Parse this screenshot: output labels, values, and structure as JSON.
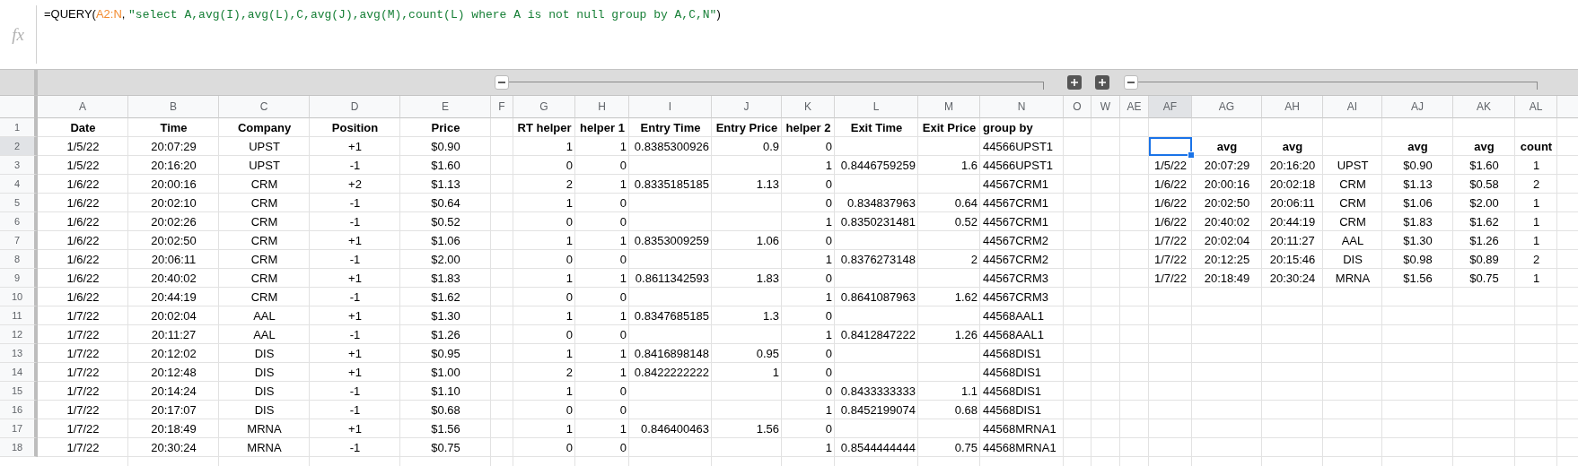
{
  "formula_bar": {
    "fx_label": "fx",
    "formula_parts": [
      {
        "kind": "plain",
        "text": "=QUERY("
      },
      {
        "kind": "range",
        "text": "A2:N"
      },
      {
        "kind": "plain",
        "text": ", "
      },
      {
        "kind": "string",
        "text": "\"select A,avg(I),avg(L),C,avg(J),avg(M),count(L) where A is not null group by A,C,N\""
      },
      {
        "kind": "plain",
        "text": ")"
      }
    ]
  },
  "column_groups": [
    {
      "expanded": true
    },
    {
      "expanded": false
    },
    {
      "expanded": false
    },
    {
      "expanded": true
    }
  ],
  "columns": [
    {
      "label": "A",
      "selected": false
    },
    {
      "label": "B",
      "selected": false
    },
    {
      "label": "C",
      "selected": false
    },
    {
      "label": "D",
      "selected": false
    },
    {
      "label": "E",
      "selected": false
    },
    {
      "label": "F",
      "selected": false
    },
    {
      "label": "G",
      "selected": false
    },
    {
      "label": "H",
      "selected": false
    },
    {
      "label": "I",
      "selected": false
    },
    {
      "label": "J",
      "selected": false
    },
    {
      "label": "K",
      "selected": false
    },
    {
      "label": "L",
      "selected": false
    },
    {
      "label": "M",
      "selected": false
    },
    {
      "label": "N",
      "selected": false
    },
    {
      "label": "O",
      "selected": false
    },
    {
      "label": "W",
      "selected": false
    },
    {
      "label": "AE",
      "selected": false
    },
    {
      "label": "AF",
      "selected": true
    },
    {
      "label": "AG",
      "selected": false
    },
    {
      "label": "AH",
      "selected": false
    },
    {
      "label": "AI",
      "selected": false
    },
    {
      "label": "AJ",
      "selected": false
    },
    {
      "label": "AK",
      "selected": false
    },
    {
      "label": "AL",
      "selected": false
    }
  ],
  "rows": [
    {
      "number": "1",
      "selected": false,
      "cells": [
        {
          "kind": "header",
          "text": "Date"
        },
        {
          "kind": "header",
          "text": "Time"
        },
        {
          "kind": "header",
          "text": "Company"
        },
        {
          "kind": "header",
          "text": "Position"
        },
        {
          "kind": "header",
          "text": "Price"
        },
        null,
        {
          "kind": "header",
          "text": "RT helper"
        },
        {
          "kind": "header",
          "text": "helper 1"
        },
        {
          "kind": "header",
          "text": "Entry Time"
        },
        {
          "kind": "header",
          "text": "Entry Price"
        },
        {
          "kind": "header",
          "text": "helper 2"
        },
        {
          "kind": "header",
          "text": "Exit Time"
        },
        {
          "kind": "header",
          "text": "Exit Price"
        },
        {
          "kind": "header",
          "text": "group by"
        }
      ]
    },
    {
      "number": "2",
      "selected": true,
      "cells": [
        "1/5/22",
        "20:07:29",
        "UPST",
        "+1",
        "$0.90",
        null,
        "1",
        "1",
        "0.8385300926",
        "0.9",
        "0",
        null,
        null,
        "44566UPST1",
        null,
        null,
        null,
        null,
        {
          "kind": "header",
          "text": "avg"
        },
        {
          "kind": "header",
          "text": "avg"
        },
        null,
        {
          "kind": "header",
          "text": "avg"
        },
        {
          "kind": "header",
          "text": "avg"
        },
        {
          "kind": "header",
          "text": "count"
        }
      ]
    },
    {
      "number": "3",
      "selected": false,
      "cells": [
        "1/5/22",
        "20:16:20",
        "UPST",
        "-1",
        "$1.60",
        null,
        "0",
        "0",
        null,
        null,
        "1",
        "0.8446759259",
        "1.6",
        "44566UPST1",
        null,
        null,
        null,
        "1/5/22",
        "20:07:29",
        "20:16:20",
        "UPST",
        "$0.90",
        "$1.60",
        "1"
      ]
    },
    {
      "number": "4",
      "selected": false,
      "cells": [
        "1/6/22",
        "20:00:16",
        "CRM",
        "+2",
        "$1.13",
        null,
        "2",
        "1",
        "0.8335185185",
        "1.13",
        "0",
        null,
        null,
        "44567CRM1",
        null,
        null,
        null,
        "1/6/22",
        "20:00:16",
        "20:02:18",
        "CRM",
        "$1.13",
        "$0.58",
        "2"
      ]
    },
    {
      "number": "5",
      "selected": false,
      "cells": [
        "1/6/22",
        "20:02:10",
        "CRM",
        "-1",
        "$0.64",
        null,
        "1",
        "0",
        null,
        null,
        "0",
        "0.834837963",
        "0.64",
        "44567CRM1",
        null,
        null,
        null,
        "1/6/22",
        "20:02:50",
        "20:06:11",
        "CRM",
        "$1.06",
        "$2.00",
        "1"
      ]
    },
    {
      "number": "6",
      "selected": false,
      "cells": [
        "1/6/22",
        "20:02:26",
        "CRM",
        "-1",
        "$0.52",
        null,
        "0",
        "0",
        null,
        null,
        "1",
        "0.8350231481",
        "0.52",
        "44567CRM1",
        null,
        null,
        null,
        "1/6/22",
        "20:40:02",
        "20:44:19",
        "CRM",
        "$1.83",
        "$1.62",
        "1"
      ]
    },
    {
      "number": "7",
      "selected": false,
      "cells": [
        "1/6/22",
        "20:02:50",
        "CRM",
        "+1",
        "$1.06",
        null,
        "1",
        "1",
        "0.8353009259",
        "1.06",
        "0",
        null,
        null,
        "44567CRM2",
        null,
        null,
        null,
        "1/7/22",
        "20:02:04",
        "20:11:27",
        "AAL",
        "$1.30",
        "$1.26",
        "1"
      ]
    },
    {
      "number": "8",
      "selected": false,
      "cells": [
        "1/6/22",
        "20:06:11",
        "CRM",
        "-1",
        "$2.00",
        null,
        "0",
        "0",
        null,
        null,
        "1",
        "0.8376273148",
        "2",
        "44567CRM2",
        null,
        null,
        null,
        "1/7/22",
        "20:12:25",
        "20:15:46",
        "DIS",
        "$0.98",
        "$0.89",
        "2"
      ]
    },
    {
      "number": "9",
      "selected": false,
      "cells": [
        "1/6/22",
        "20:40:02",
        "CRM",
        "+1",
        "$1.83",
        null,
        "1",
        "1",
        "0.8611342593",
        "1.83",
        "0",
        null,
        null,
        "44567CRM3",
        null,
        null,
        null,
        "1/7/22",
        "20:18:49",
        "20:30:24",
        "MRNA",
        "$1.56",
        "$0.75",
        "1"
      ]
    },
    {
      "number": "10",
      "selected": false,
      "cells": [
        "1/6/22",
        "20:44:19",
        "CRM",
        "-1",
        "$1.62",
        null,
        "0",
        "0",
        null,
        null,
        "1",
        "0.8641087963",
        "1.62",
        "44567CRM3"
      ]
    },
    {
      "number": "11",
      "selected": false,
      "cells": [
        "1/7/22",
        "20:02:04",
        "AAL",
        "+1",
        "$1.30",
        null,
        "1",
        "1",
        "0.8347685185",
        "1.3",
        "0",
        null,
        null,
        "44568AAL1"
      ]
    },
    {
      "number": "12",
      "selected": false,
      "cells": [
        "1/7/22",
        "20:11:27",
        "AAL",
        "-1",
        "$1.26",
        null,
        "0",
        "0",
        null,
        null,
        "1",
        "0.8412847222",
        "1.26",
        "44568AAL1"
      ]
    },
    {
      "number": "13",
      "selected": false,
      "cells": [
        "1/7/22",
        "20:12:02",
        "DIS",
        "+1",
        "$0.95",
        null,
        "1",
        "1",
        "0.8416898148",
        "0.95",
        "0",
        null,
        null,
        "44568DIS1"
      ]
    },
    {
      "number": "14",
      "selected": false,
      "cells": [
        "1/7/22",
        "20:12:48",
        "DIS",
        "+1",
        "$1.00",
        null,
        "2",
        "1",
        "0.8422222222",
        "1",
        "0",
        null,
        null,
        "44568DIS1"
      ]
    },
    {
      "number": "15",
      "selected": false,
      "cells": [
        "1/7/22",
        "20:14:24",
        "DIS",
        "-1",
        "$1.10",
        null,
        "1",
        "0",
        null,
        null,
        "0",
        "0.8433333333",
        "1.1",
        "44568DIS1"
      ]
    },
    {
      "number": "16",
      "selected": false,
      "cells": [
        "1/7/22",
        "20:17:07",
        "DIS",
        "-1",
        "$0.68",
        null,
        "0",
        "0",
        null,
        null,
        "1",
        "0.8452199074",
        "0.68",
        "44568DIS1"
      ]
    },
    {
      "number": "17",
      "selected": false,
      "cells": [
        "1/7/22",
        "20:18:49",
        "MRNA",
        "+1",
        "$1.56",
        null,
        "1",
        "1",
        "0.846400463",
        "1.56",
        "0",
        null,
        null,
        "44568MRNA1"
      ]
    },
    {
      "number": "18",
      "selected": false,
      "cells": [
        "1/7/22",
        "20:30:24",
        "MRNA",
        "-1",
        "$0.75",
        null,
        "0",
        "0",
        null,
        null,
        "1",
        "0.8544444444",
        "0.75",
        "44568MRNA1"
      ]
    }
  ]
}
